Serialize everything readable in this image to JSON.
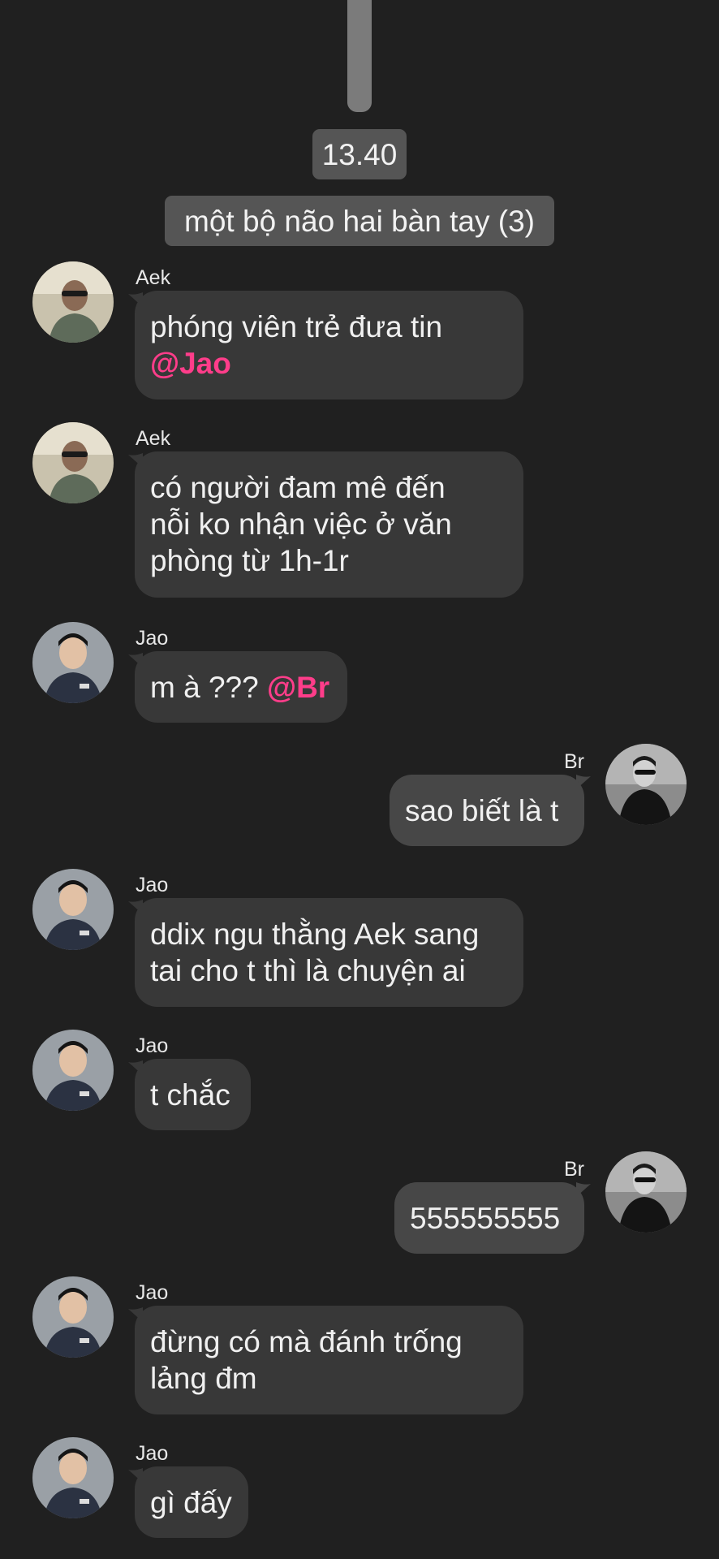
{
  "time_label": "13.40",
  "group_event": "một bộ não hai bàn tay (3)",
  "messages": [
    {
      "sender": "Aek",
      "text": "phóng viên trẻ đưa tin\n",
      "mention": "@Jao"
    },
    {
      "sender": "Aek",
      "text": "có người đam mê đến\nnỗi ko nhận việc ở văn\nphòng từ 1h-1r",
      "mention": ""
    },
    {
      "sender": "Jao",
      "text": "m à ??? ",
      "mention": "@Br"
    },
    {
      "sender": "Br",
      "text": "sao biết là t",
      "mention": ""
    },
    {
      "sender": "Jao",
      "text": "ddix ngu thằng Aek sang\ntai cho t thì là chuyện ai",
      "mention": ""
    },
    {
      "sender": "Jao",
      "text": "t chắc",
      "mention": ""
    },
    {
      "sender": "Br",
      "text": "555555555",
      "mention": ""
    },
    {
      "sender": "Jao",
      "text": "đừng có mà đánh trống\nlảng đm",
      "mention": ""
    },
    {
      "sender": "Jao",
      "text": "gì đấy",
      "mention": ""
    }
  ],
  "colors": {
    "background": "#202020",
    "incoming_bubble": "#383838",
    "outgoing_bubble": "#474747",
    "mention": "#ff3d8a",
    "pill": "#555555"
  }
}
